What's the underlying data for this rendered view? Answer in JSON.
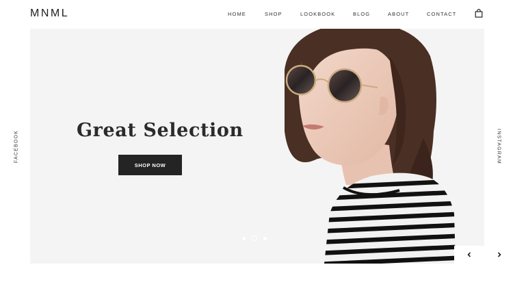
{
  "brand": {
    "logo": "MNML"
  },
  "nav": {
    "items": [
      {
        "label": "HOME"
      },
      {
        "label": "SHOP"
      },
      {
        "label": "LOOKBOOK"
      },
      {
        "label": "BLOG"
      },
      {
        "label": "ABOUT"
      },
      {
        "label": "CONTACT"
      }
    ],
    "cart_icon": "shopping-bag-icon"
  },
  "hero": {
    "headline": "Great Selection",
    "cta_label": "SHOP NOW",
    "slides": {
      "count": 3,
      "active_index": 1
    }
  },
  "social": {
    "left": "FACEBOOK",
    "right": "INSTAGRAM"
  },
  "slider_controls": {
    "prev_icon": "chevron-left-icon",
    "next_icon": "chevron-right-icon"
  },
  "colors": {
    "hero_background": "#f4f4f4",
    "button_background": "#242424",
    "text": "#222222"
  }
}
